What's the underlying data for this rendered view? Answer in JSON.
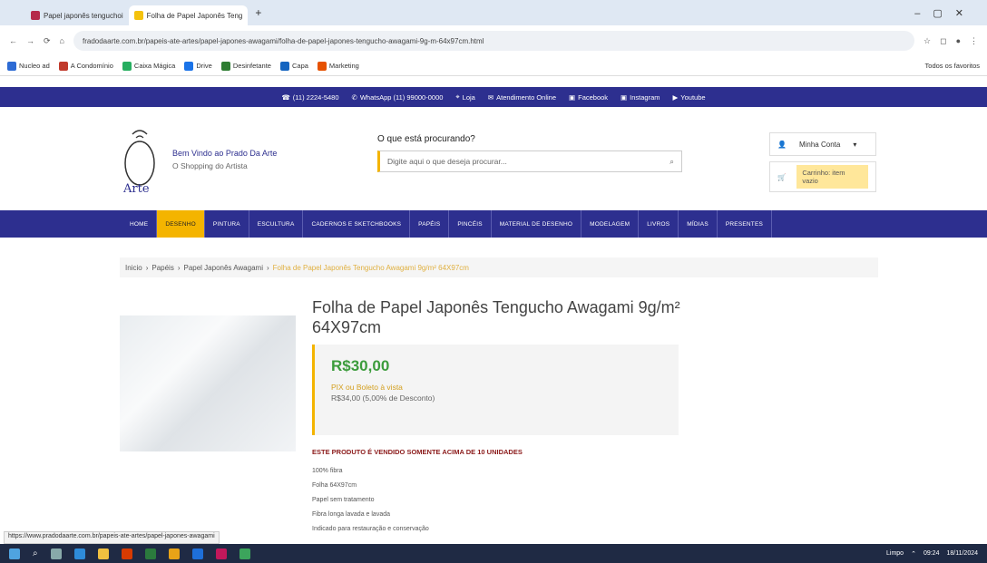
{
  "browser": {
    "tabs": [
      {
        "label": "Papel japonês tenguchoi",
        "active": false
      },
      {
        "label": "Folha de Papel Japonês Teng",
        "active": true
      }
    ],
    "url": "fradodaarte.com.br/papeis-ate-artes/papel-japones-awagami/folha-de-papel-japones-tengucho-awagami-9g-m-64x97cm.html",
    "bookmarks": [
      "Nucleo ad",
      "A Condomínio",
      "Caixa Mágica",
      "Drive",
      "Desinfetante",
      "Capa",
      "Marketing",
      "Todos os favoritos"
    ]
  },
  "topbar": {
    "items": [
      "(11) 2224-5480",
      "WhatsApp (11) 99000-0000",
      "Loja",
      "Atendimento Online",
      "Facebook",
      "Instagram",
      "Youtube"
    ]
  },
  "header": {
    "brand": "Bem Vindo ao Prado Da Arte",
    "brand_sub": "O Shopping do Artista",
    "search_question": "O que está procurando?",
    "search_placeholder": "Digite aqui o que deseja procurar...",
    "account_label": "Minha Conta",
    "cart_label": "Carrinho: item vazio"
  },
  "nav": {
    "items": [
      "HOME",
      "DESENHO",
      "PINTURA",
      "ESCULTURA",
      "CADERNOS E SKETCHBOOKS",
      "PAPÉIS",
      "PINCÉIS",
      "MATERIAL DE DESENHO",
      "MODELAGEM",
      "LIVROS",
      "MÍDIAS",
      "PRESENTES"
    ],
    "active_index": 1
  },
  "breadcrumb": {
    "items": [
      "Inicio",
      "Papéis",
      "Papel Japonês Awagami"
    ],
    "current": "Folha de Papel Japonês Tengucho Awagami 9g/m² 64X97cm"
  },
  "product": {
    "title": "Folha de Papel Japonês Tengucho Awagami 9g/m² 64X97cm",
    "price": "R$30,00",
    "installments": "PIX ou Boleto à vista",
    "discount": "R$34,00 (5,00% de Desconto)",
    "notice": "ESTE PRODUTO É VENDIDO SOMENTE ACIMA DE 10 UNIDADES",
    "features": [
      "100% fibra",
      "Folha 64X97cm",
      "Papel sem tratamento",
      "Fibra longa lavada e lavada",
      "Indicado para restauração e conservação"
    ]
  },
  "status_bar": "https://www.pradodaarte.com.br/papeis-ate-artes/papel-japones-awagami",
  "taskbar": {
    "time": "09:24",
    "date": "18/11/2024",
    "weather": "Limpo"
  },
  "colors": {
    "brand": "#2d2f8f",
    "accent": "#f4b400",
    "price": "#3c9c3c"
  }
}
